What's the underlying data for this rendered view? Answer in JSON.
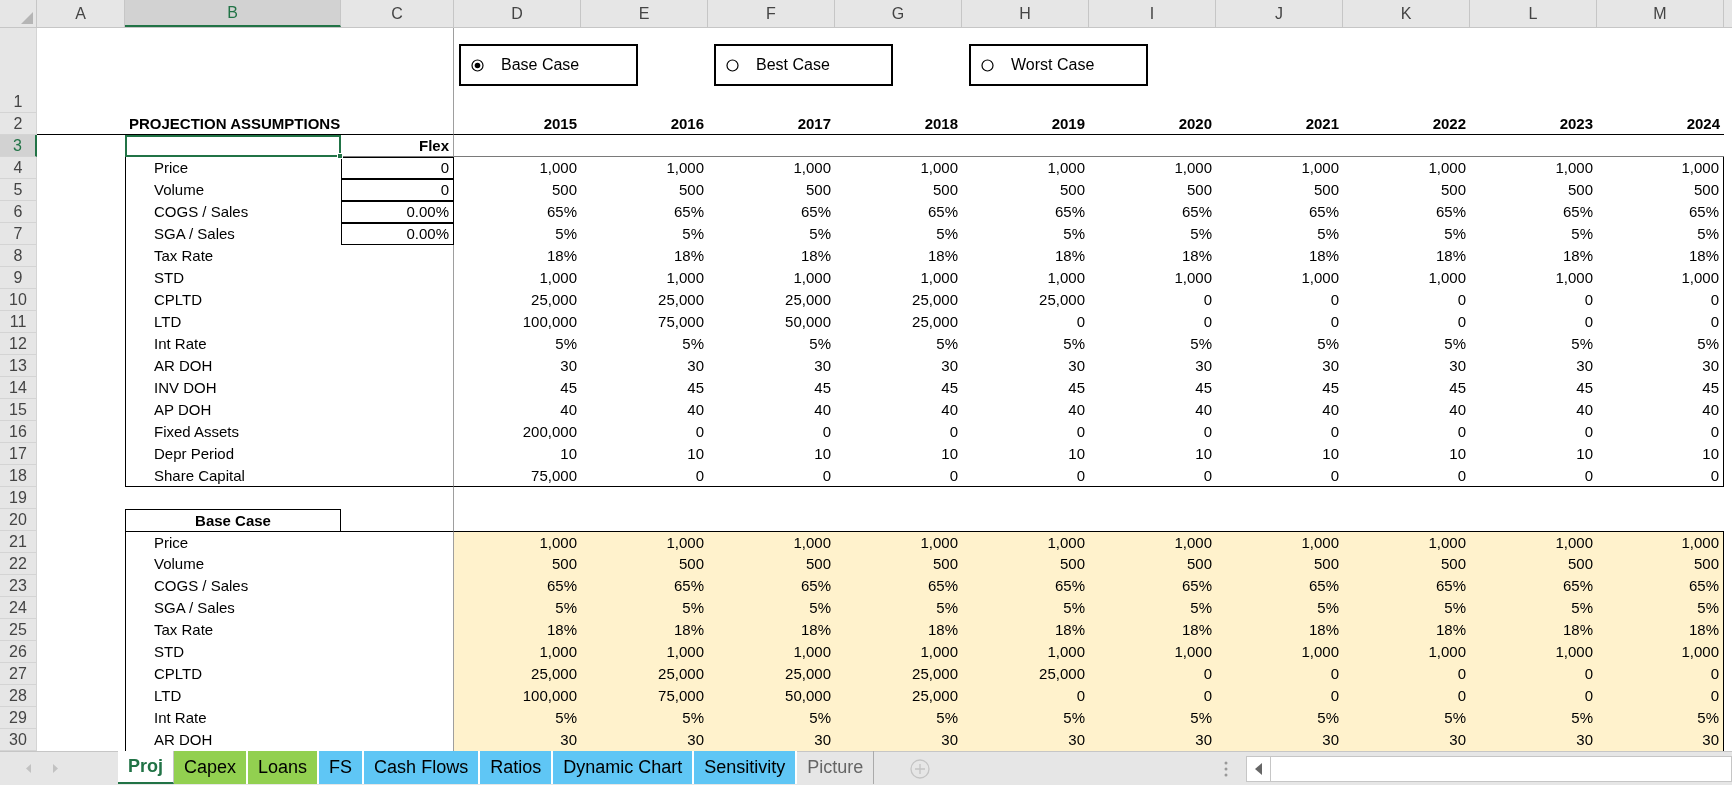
{
  "column_headers": [
    {
      "label": "A",
      "selected": false
    },
    {
      "label": "B",
      "selected": true
    },
    {
      "label": "C",
      "selected": false
    },
    {
      "label": "D",
      "selected": false
    },
    {
      "label": "E",
      "selected": false
    },
    {
      "label": "F",
      "selected": false
    },
    {
      "label": "G",
      "selected": false
    },
    {
      "label": "H",
      "selected": false
    },
    {
      "label": "I",
      "selected": false
    },
    {
      "label": "J",
      "selected": false
    },
    {
      "label": "K",
      "selected": false
    },
    {
      "label": "L",
      "selected": false
    },
    {
      "label": "M",
      "selected": false
    }
  ],
  "options": [
    {
      "label": "Base Case",
      "selected": true
    },
    {
      "label": "Best Case",
      "selected": false
    },
    {
      "label": "Worst Case",
      "selected": false
    }
  ],
  "rows": [
    {
      "row": "1",
      "kind": "options",
      "selected": false
    },
    {
      "row": "2",
      "kind": "header",
      "selected": false,
      "title": "PROJECTION ASSUMPTIONS",
      "values": [
        "2015",
        "2016",
        "2017",
        "2018",
        "2019",
        "2020",
        "2021",
        "2022",
        "2023",
        "2024"
      ]
    },
    {
      "row": "3",
      "kind": "flex_header",
      "selected": true,
      "flex": "Flex"
    },
    {
      "row": "4",
      "kind": "flex",
      "selected": false,
      "label": "Price",
      "flex": "0",
      "values": [
        "1,000",
        "1,000",
        "1,000",
        "1,000",
        "1,000",
        "1,000",
        "1,000",
        "1,000",
        "1,000",
        "1,000"
      ]
    },
    {
      "row": "5",
      "kind": "flex",
      "selected": false,
      "label": "Volume",
      "flex": "0",
      "values": [
        "500",
        "500",
        "500",
        "500",
        "500",
        "500",
        "500",
        "500",
        "500",
        "500"
      ]
    },
    {
      "row": "6",
      "kind": "flex",
      "selected": false,
      "label": "COGS / Sales",
      "flex": "0.00%",
      "values": [
        "65%",
        "65%",
        "65%",
        "65%",
        "65%",
        "65%",
        "65%",
        "65%",
        "65%",
        "65%"
      ]
    },
    {
      "row": "7",
      "kind": "flex",
      "selected": false,
      "label": "SGA / Sales",
      "flex": "0.00%",
      "values": [
        "5%",
        "5%",
        "5%",
        "5%",
        "5%",
        "5%",
        "5%",
        "5%",
        "5%",
        "5%"
      ]
    },
    {
      "row": "8",
      "kind": "flex",
      "selected": false,
      "label": "Tax Rate",
      "values": [
        "18%",
        "18%",
        "18%",
        "18%",
        "18%",
        "18%",
        "18%",
        "18%",
        "18%",
        "18%"
      ]
    },
    {
      "row": "9",
      "kind": "flex",
      "selected": false,
      "label": "STD",
      "values": [
        "1,000",
        "1,000",
        "1,000",
        "1,000",
        "1,000",
        "1,000",
        "1,000",
        "1,000",
        "1,000",
        "1,000"
      ]
    },
    {
      "row": "10",
      "kind": "flex",
      "selected": false,
      "label": "CPLTD",
      "values": [
        "25,000",
        "25,000",
        "25,000",
        "25,000",
        "25,000",
        "0",
        "0",
        "0",
        "0",
        "0"
      ]
    },
    {
      "row": "11",
      "kind": "flex",
      "selected": false,
      "label": "LTD",
      "values": [
        "100,000",
        "75,000",
        "50,000",
        "25,000",
        "0",
        "0",
        "0",
        "0",
        "0",
        "0"
      ]
    },
    {
      "row": "12",
      "kind": "flex",
      "selected": false,
      "label": "Int Rate",
      "values": [
        "5%",
        "5%",
        "5%",
        "5%",
        "5%",
        "5%",
        "5%",
        "5%",
        "5%",
        "5%"
      ]
    },
    {
      "row": "13",
      "kind": "flex",
      "selected": false,
      "label": "AR DOH",
      "values": [
        "30",
        "30",
        "30",
        "30",
        "30",
        "30",
        "30",
        "30",
        "30",
        "30"
      ]
    },
    {
      "row": "14",
      "kind": "flex",
      "selected": false,
      "label": "INV DOH",
      "values": [
        "45",
        "45",
        "45",
        "45",
        "45",
        "45",
        "45",
        "45",
        "45",
        "45"
      ]
    },
    {
      "row": "15",
      "kind": "flex",
      "selected": false,
      "label": "AP DOH",
      "values": [
        "40",
        "40",
        "40",
        "40",
        "40",
        "40",
        "40",
        "40",
        "40",
        "40"
      ]
    },
    {
      "row": "16",
      "kind": "flex",
      "selected": false,
      "label": "Fixed Assets",
      "values": [
        "200,000",
        "0",
        "0",
        "0",
        "0",
        "0",
        "0",
        "0",
        "0",
        "0"
      ]
    },
    {
      "row": "17",
      "kind": "flex",
      "selected": false,
      "label": "Depr Period",
      "values": [
        "10",
        "10",
        "10",
        "10",
        "10",
        "10",
        "10",
        "10",
        "10",
        "10"
      ]
    },
    {
      "row": "18",
      "kind": "flex",
      "selected": false,
      "label": "Share Capital",
      "values": [
        "75,000",
        "0",
        "0",
        "0",
        "0",
        "0",
        "0",
        "0",
        "0",
        "0"
      ]
    },
    {
      "row": "19",
      "kind": "blank",
      "selected": false
    },
    {
      "row": "20",
      "kind": "section",
      "selected": false,
      "label": "Base Case"
    },
    {
      "row": "21",
      "kind": "base",
      "selected": false,
      "label": "Price",
      "values": [
        "1,000",
        "1,000",
        "1,000",
        "1,000",
        "1,000",
        "1,000",
        "1,000",
        "1,000",
        "1,000",
        "1,000"
      ]
    },
    {
      "row": "22",
      "kind": "base",
      "selected": false,
      "label": "Volume",
      "values": [
        "500",
        "500",
        "500",
        "500",
        "500",
        "500",
        "500",
        "500",
        "500",
        "500"
      ]
    },
    {
      "row": "23",
      "kind": "base",
      "selected": false,
      "label": "COGS / Sales",
      "values": [
        "65%",
        "65%",
        "65%",
        "65%",
        "65%",
        "65%",
        "65%",
        "65%",
        "65%",
        "65%"
      ]
    },
    {
      "row": "24",
      "kind": "base",
      "selected": false,
      "label": "SGA / Sales",
      "values": [
        "5%",
        "5%",
        "5%",
        "5%",
        "5%",
        "5%",
        "5%",
        "5%",
        "5%",
        "5%"
      ]
    },
    {
      "row": "25",
      "kind": "base",
      "selected": false,
      "label": "Tax Rate",
      "values": [
        "18%",
        "18%",
        "18%",
        "18%",
        "18%",
        "18%",
        "18%",
        "18%",
        "18%",
        "18%"
      ]
    },
    {
      "row": "26",
      "kind": "base",
      "selected": false,
      "label": "STD",
      "values": [
        "1,000",
        "1,000",
        "1,000",
        "1,000",
        "1,000",
        "1,000",
        "1,000",
        "1,000",
        "1,000",
        "1,000"
      ]
    },
    {
      "row": "27",
      "kind": "base",
      "selected": false,
      "label": "CPLTD",
      "values": [
        "25,000",
        "25,000",
        "25,000",
        "25,000",
        "25,000",
        "0",
        "0",
        "0",
        "0",
        "0"
      ]
    },
    {
      "row": "28",
      "kind": "base",
      "selected": false,
      "label": "LTD",
      "values": [
        "100,000",
        "75,000",
        "50,000",
        "25,000",
        "0",
        "0",
        "0",
        "0",
        "0",
        "0"
      ]
    },
    {
      "row": "29",
      "kind": "base",
      "selected": false,
      "label": "Int Rate",
      "values": [
        "5%",
        "5%",
        "5%",
        "5%",
        "5%",
        "5%",
        "5%",
        "5%",
        "5%",
        "5%"
      ]
    },
    {
      "row": "30",
      "kind": "base",
      "selected": false,
      "label": "AR DOH",
      "values": [
        "30",
        "30",
        "30",
        "30",
        "30",
        "30",
        "30",
        "30",
        "30",
        "30"
      ]
    }
  ],
  "tabs": [
    {
      "label": "Proj",
      "selected": true
    },
    {
      "label": "Capex",
      "selected": false,
      "color": "#92d050"
    },
    {
      "label": "Loans",
      "selected": false,
      "color": "#92d050"
    },
    {
      "label": "FS",
      "selected": false,
      "color": "#5fc6f5"
    },
    {
      "label": "Cash Flows",
      "selected": false,
      "color": "#5fc6f5"
    },
    {
      "label": "Ratios",
      "selected": false,
      "color": "#5fc6f5"
    },
    {
      "label": "Dynamic Chart",
      "selected": false,
      "color": "#5fc6f5"
    },
    {
      "label": "Sensitivity",
      "selected": false,
      "color": "#5fc6f5"
    },
    {
      "label": "Picture",
      "selected": false
    }
  ]
}
